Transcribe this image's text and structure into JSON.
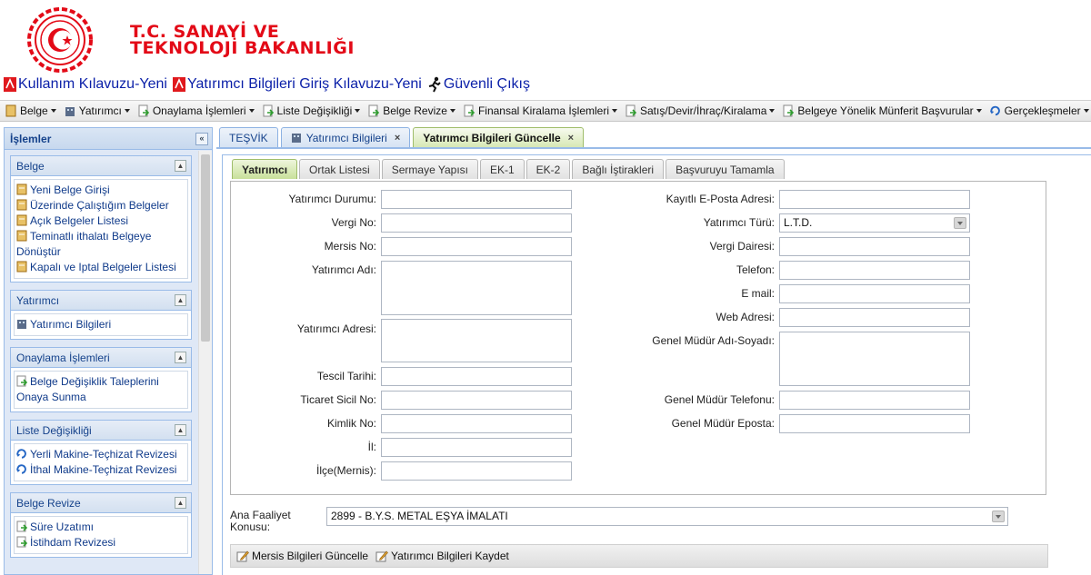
{
  "brand": {
    "line1": "T.C. SANAYİ VE",
    "line2": "TEKNOLOJİ BAKANLIĞI",
    "color": "#e30a17"
  },
  "top_links": [
    {
      "label": "Kullanım Kılavuzu-Yeni",
      "icon": "pdf-icon"
    },
    {
      "label": "Yatırımcı Bilgileri Giriş Kılavuzu-Yeni",
      "icon": "pdf-icon"
    },
    {
      "label": "Güvenli Çıkış",
      "icon": "runner-icon"
    }
  ],
  "menu": [
    "Belge",
    "Yatırımcı",
    "Onaylama İşlemleri",
    "Liste Değişikliği",
    "Belge Revize",
    "Finansal Kiralama İşlemleri",
    "Satış/Devir/İhraç/Kiralama",
    "Belgeye Yönelik Münferit Başvurular",
    "Gerçekleşmeler"
  ],
  "sidebar": {
    "title": "İşlemler",
    "collapse_symbol": "«",
    "panels": [
      {
        "title": "Belge",
        "items": [
          "Yeni Belge Girişi",
          "Üzerinde Çalıştığım Belgeler",
          "Açık Belgeler Listesi",
          "Teminatlı ithalatı Belgeye Dönüştür",
          "Kapalı ve Iptal Belgeler Listesi"
        ]
      },
      {
        "title": "Yatırımcı",
        "items": [
          "Yatırımcı Bilgileri"
        ]
      },
      {
        "title": "Onaylama İşlemleri",
        "items": [
          "Belge Değişiklik Taleplerini Onaya Sunma"
        ]
      },
      {
        "title": "Liste Değişikliği",
        "items": [
          "Yerli Makine-Teçhizat Revizesi",
          "İthal Makine-Teçhizat Revizesi"
        ]
      },
      {
        "title": "Belge Revize",
        "items": [
          "Süre Uzatımı",
          "İstihdam Revizesi"
        ]
      }
    ]
  },
  "tabs": [
    {
      "label": "TEŞVİK",
      "closable": false
    },
    {
      "label": "Yatırımcı Bilgileri",
      "closable": true
    },
    {
      "label": "Yatırımcı Bilgileri Güncelle",
      "closable": true,
      "active": true
    }
  ],
  "subtabs": [
    "Yatırımcı",
    "Ortak Listesi",
    "Sermaye Yapısı",
    "EK-1",
    "EK-2",
    "Bağlı İştirakleri",
    "Başvuruyu Tamamla"
  ],
  "form": {
    "left": {
      "status_label": "Yatırımcı Durumu:",
      "status_value": "",
      "tax_no_label": "Vergi No:",
      "tax_no_value": "",
      "mersis_label": "Mersis No:",
      "mersis_value": "",
      "name_label": "Yatırımcı Adı:",
      "name_value": "",
      "address_label": "Yatırımcı Adresi:",
      "address_value": "",
      "reg_date_label": "Tescil Tarihi:",
      "reg_date_value": "",
      "trade_reg_label": "Ticaret Sicil No:",
      "trade_reg_value": "",
      "id_no_label": "Kimlik No:",
      "id_no_value": "",
      "city_label": "İl:",
      "city_value": "",
      "district_label": "İlçe(Mernis):",
      "district_value": ""
    },
    "right": {
      "kep_label": "Kayıtlı E-Posta Adresi:",
      "kep_value": "",
      "type_label": "Yatırımcı Türü:",
      "type_value": "L.T.D.",
      "tax_office_label": "Vergi Dairesi:",
      "tax_office_value": "",
      "phone_label": "Telefon:",
      "phone_value": "",
      "email_label": "E mail:",
      "email_value": "",
      "web_label": "Web Adresi:",
      "web_value": "",
      "gm_name_label": "Genel Müdür Adı-Soyadı:",
      "gm_name_value": "",
      "gm_phone_label": "Genel Müdür Telefonu:",
      "gm_phone_value": "",
      "gm_email_label": "Genel Müdür Eposta:",
      "gm_email_value": ""
    },
    "activity_label": "Ana Faaliyet Konusu:",
    "activity_value": "2899 - B.Y.S. METAL EŞYA İMALATI"
  },
  "actions": {
    "mersis_update": "Mersis Bilgileri Güncelle",
    "save": "Yatırımcı Bilgileri Kaydet"
  }
}
